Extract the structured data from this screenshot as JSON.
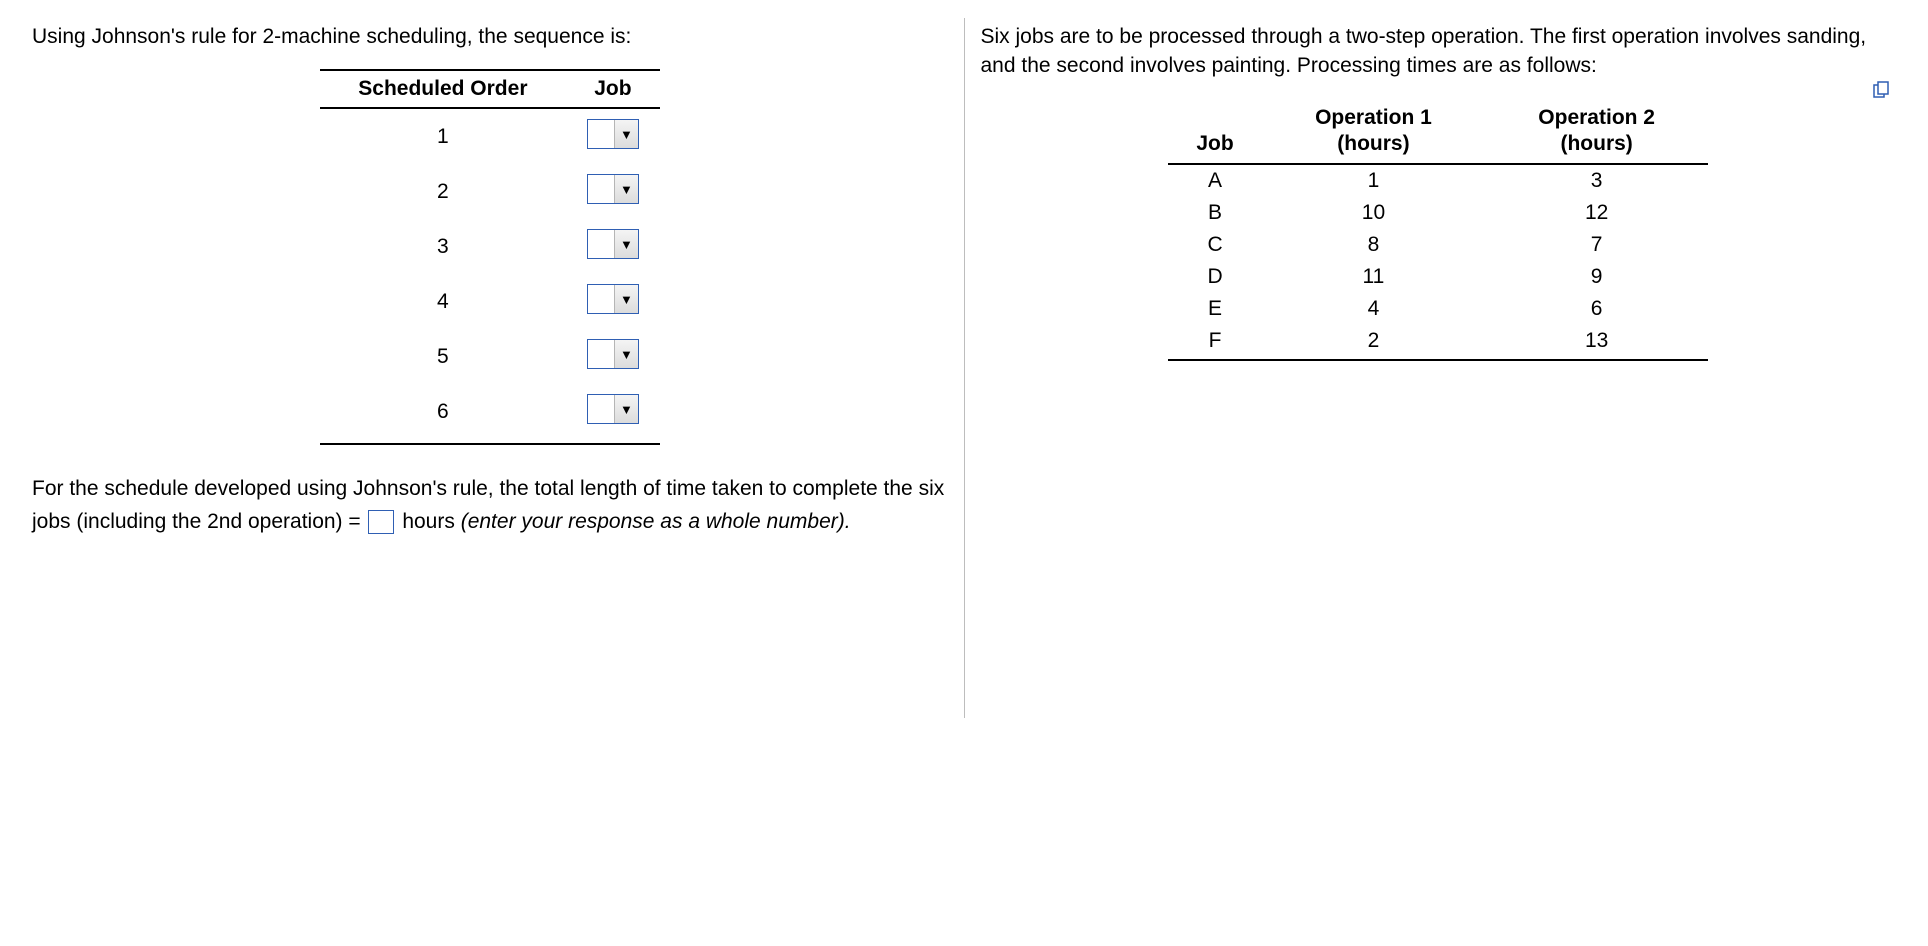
{
  "left": {
    "intro": "Using Johnson's rule for 2-machine scheduling, the sequence is:",
    "headers": [
      "Scheduled Order",
      "Job"
    ],
    "orders": [
      "1",
      "2",
      "3",
      "4",
      "5",
      "6"
    ],
    "after_part1": "For the schedule developed using Johnson's rule, the total length of time taken to complete the six jobs (including the 2nd operation) = ",
    "after_part2": " hours ",
    "after_hint": "(enter your response as a whole number)."
  },
  "right": {
    "intro": "Six jobs are to be processed through a two-step operation.  The first operation involves sanding, and the second involves painting. Processing times are as follows:",
    "headers": {
      "job": "Job",
      "op1a": "Operation 1",
      "op1b": "(hours)",
      "op2a": "Operation 2",
      "op2b": "(hours)"
    },
    "rows": [
      {
        "job": "A",
        "op1": "1",
        "op2": "3"
      },
      {
        "job": "B",
        "op1": "10",
        "op2": "12"
      },
      {
        "job": "C",
        "op1": "8",
        "op2": "7"
      },
      {
        "job": "D",
        "op1": "11",
        "op2": "9"
      },
      {
        "job": "E",
        "op1": "4",
        "op2": "6"
      },
      {
        "job": "F",
        "op1": "2",
        "op2": "13"
      }
    ]
  }
}
